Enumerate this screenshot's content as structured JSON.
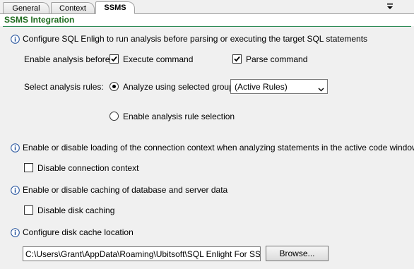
{
  "tabs": [
    {
      "label": "General",
      "active": false
    },
    {
      "label": "Context",
      "active": false
    },
    {
      "label": "SSMS",
      "active": true
    }
  ],
  "section": {
    "title": "SSMS Integration"
  },
  "analysis": {
    "description": "Configure SQL Enligh to run analysis before parsing or executing the target SQL statements",
    "enable_label": "Enable analysis before:",
    "execute_command": {
      "label": "Execute command",
      "checked": true
    },
    "parse_command": {
      "label": "Parse command",
      "checked": true
    },
    "rules_label": "Select analysis rules:",
    "analyze_group": {
      "label": "Analyze using selected group",
      "selected": true
    },
    "group_select": {
      "value": "(Active Rules)"
    },
    "enable_selection": {
      "label": "Enable analysis rule selection",
      "selected": false
    }
  },
  "connection": {
    "description": "Enable or disable loading of the connection context when analyzing statements in the active code window",
    "disable": {
      "label": "Disable connection context",
      "checked": false
    }
  },
  "caching": {
    "description": "Enable or disable caching of database and server data",
    "disable": {
      "label": "Disable disk caching",
      "checked": false
    }
  },
  "cache_location": {
    "description": "Configure disk cache location",
    "path": "C:\\Users\\Grant\\AppData\\Roaming\\Ubitsoft\\SQL Enlight For SSMS\\",
    "browse_label": "Browse..."
  },
  "colors": {
    "section_title": "#1e6b1e",
    "info_icon": "#1f4e9a",
    "background": "#f0f0f0"
  },
  "icons": {
    "menu": "dropdown-menu-icon",
    "info": "info-icon",
    "check": "checkmark-icon",
    "combo_arrow": "chevron-down-icon"
  }
}
